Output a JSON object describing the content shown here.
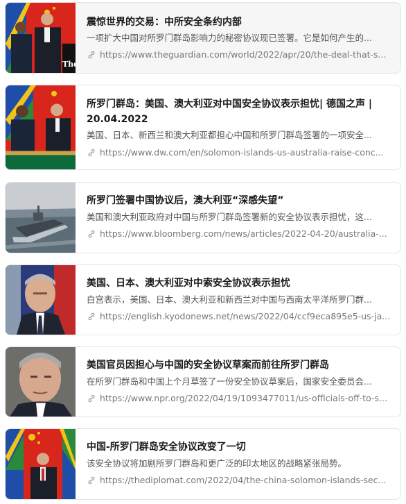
{
  "results": [
    {
      "title": "震惊世界的交易：中所安全条约内部",
      "description": "一项扩大中国对所罗门群岛影响力的秘密协议现已签署。它是如何产生的...",
      "url": "https://www.theguardian.com/world/2022/apr/20/the-deal-that-s...",
      "thumb_icon": "signing-ceremony-photo",
      "thumb_watermark": "The Gua",
      "active": true
    },
    {
      "title": "所罗门群岛：美国、澳大利亚对中国安全协议表示担忧| 德国之声 | 20.04.2022",
      "description": "美国、日本、新西兰和澳大利亚都担心中国和所罗门群岛签署的一项安全...",
      "url": "https://www.dw.com/en/solomon-islands-us-australia-raise-conc...",
      "thumb_icon": "officials-handshake-photo",
      "active": false
    },
    {
      "title": "所罗门签署中国协议后，澳大利亚“深感失望”",
      "description": "美国和澳大利亚政府对中国与所罗门群岛签署新的安全协议表示担忧，这...",
      "url": "https://www.bloomberg.com/news/articles/2022-04-20/australia-...",
      "thumb_icon": "naval-ship-photo",
      "active": false
    },
    {
      "title": "美国、日本、澳大利亚对中索安全协议表示担忧",
      "description": "白宫表示，美国、日本、澳大利亚和新西兰对中国与西南太平洋所罗门群...",
      "url": "https://english.kyodonews.net/news/2022/04/ccf9eca895e5-us-ja...",
      "thumb_icon": "official-portrait-photo",
      "active": false
    },
    {
      "title": "美国官员因担心与中国的安全协议草案而前往所罗门群岛",
      "description": "在所罗门群岛和中国上个月草签了一份安全协议草案后，国家安全委员会...",
      "url": "https://www.npr.org/2022/04/19/1093477011/us-officials-off-to-s...",
      "thumb_icon": "official-closeup-photo",
      "active": false
    },
    {
      "title": "中国-所罗门群岛安全协议改变了一切",
      "description": "该安全协议将加剧所罗门群岛和更广泛的印太地区的战略紧张局势。",
      "url": "https://thediplomat.com/2022/04/the-china-solomon-islands-sec...",
      "thumb_icon": "leader-flags-photo",
      "active": false
    }
  ],
  "colors": {
    "flag_red": "#d8261c",
    "flag_blue": "#1f4ea8",
    "flag_green": "#2a8a3c",
    "flag_yellow": "#f2c417",
    "link_gray": "#888888"
  }
}
